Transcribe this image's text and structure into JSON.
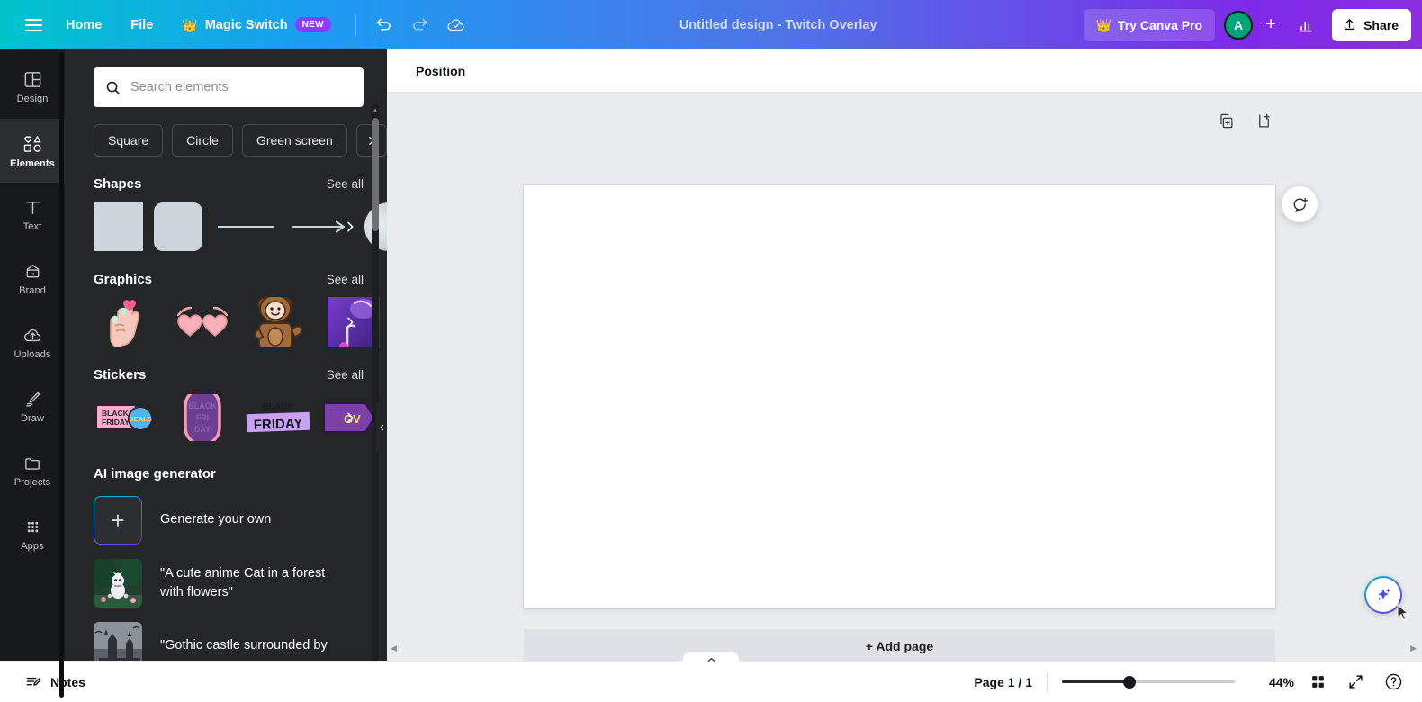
{
  "topbar": {
    "menu_icon": "hamburger-icon",
    "home_label": "Home",
    "file_label": "File",
    "magic_switch_label": "Magic Switch",
    "magic_switch_crown": "♛",
    "new_badge": "NEW",
    "undo_icon": "undo-icon",
    "redo_icon": "redo-icon",
    "cloud_saved_icon": "cloud-check-icon",
    "doc_title": "Untitled design - Twitch Overlay",
    "try_pro_label": "Try Canva Pro",
    "try_pro_crown": "♛",
    "avatar_initial": "A",
    "invite_plus": "+",
    "insights_icon": "bar-chart-icon",
    "share_label": "Share"
  },
  "rail": {
    "items": [
      {
        "label": "Design",
        "icon": "design-layout-icon",
        "active": false
      },
      {
        "label": "Elements",
        "icon": "elements-shapes-icon",
        "active": true
      },
      {
        "label": "Text",
        "icon": "text-t-icon",
        "active": false
      },
      {
        "label": "Brand",
        "icon": "brand-icon",
        "active": false
      },
      {
        "label": "Uploads",
        "icon": "upload-cloud-icon",
        "active": false
      },
      {
        "label": "Draw",
        "icon": "draw-pen-icon",
        "active": false
      },
      {
        "label": "Projects",
        "icon": "folder-icon",
        "active": false
      },
      {
        "label": "Apps",
        "icon": "apps-grid-icon",
        "active": false
      }
    ]
  },
  "panel": {
    "search": {
      "placeholder": "Search elements",
      "value": "",
      "icon": "search-icon"
    },
    "chips": [
      "Square",
      "Circle",
      "Green screen"
    ],
    "chip_next_icon": "chevron-right-icon",
    "sections": [
      {
        "title": "Shapes",
        "see_all": "See all",
        "items": [
          "square-shape",
          "rounded-square-shape",
          "line-shape",
          "arrow-shape",
          "circle-shape"
        ]
      },
      {
        "title": "Graphics",
        "see_all": "See all",
        "items": [
          "finger-heart-hand-graphic",
          "heart-sunglasses-graphic",
          "bear-costume-person-graphic",
          "purple-abstract-graphic"
        ]
      },
      {
        "title": "Stickers",
        "see_all": "See all",
        "items": [
          "black-friday-deals-sticker",
          "black-friday-oval-sticker",
          "black-friday-brush-sticker",
          "purple-tag-sticker"
        ]
      }
    ],
    "ai": {
      "title": "AI image generator",
      "generate_label": "Generate your own",
      "generate_icon": "plus-icon",
      "prompts": [
        {
          "text": "\"A cute anime Cat in a forest with flowers\"",
          "thumb": "anime-cat-forest-thumb"
        },
        {
          "text": "\"Gothic castle surrounded by",
          "thumb": "gothic-castle-thumb"
        }
      ]
    },
    "collapse_icon": "chevron-left-icon"
  },
  "editor": {
    "toolbar": {
      "position_label": "Position"
    },
    "page_tools": [
      {
        "icon": "duplicate-page-icon",
        "name": "duplicate-page-button"
      },
      {
        "icon": "add-page-icon",
        "name": "add-page-button"
      }
    ],
    "comment_icon": "add-comment-icon",
    "add_page_label": "+ Add page",
    "magic_icon": "magic-sparkle-icon"
  },
  "bottombar": {
    "notes_label": "Notes",
    "notes_icon": "notes-icon",
    "page_count": "Page 1 / 1",
    "zoom_value": "44%",
    "zoom_percent": 44,
    "grid_icon": "grid-view-icon",
    "fullscreen_icon": "fullscreen-icon",
    "help_icon": "help-question-icon",
    "notes_tab_icon": "chevron-up-icon"
  },
  "colors": {
    "brand_teal": "#00c4cc",
    "brand_purple": "#7d2ae8",
    "badge_new": "#8b3dff",
    "avatar_green": "#00a37a",
    "panel_bg": "#252627",
    "rail_bg": "#18191b",
    "canvas_bg": "#ebecf0"
  }
}
